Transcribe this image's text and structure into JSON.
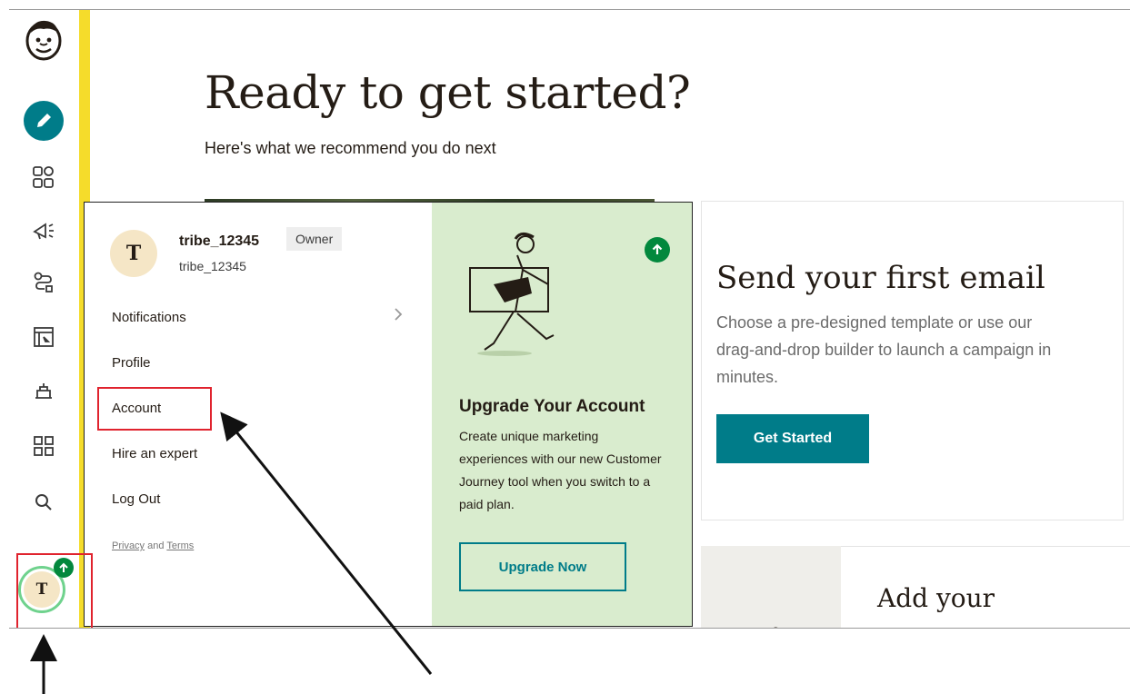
{
  "sidebar": {
    "logo": "mailchimp-freddie-logo",
    "items": [
      {
        "name": "create",
        "icon": "pencil-icon"
      },
      {
        "name": "audience",
        "icon": "audience-icon"
      },
      {
        "name": "campaigns",
        "icon": "megaphone-icon"
      },
      {
        "name": "automations",
        "icon": "automation-icon"
      },
      {
        "name": "website",
        "icon": "website-icon"
      },
      {
        "name": "content-studio",
        "icon": "content-studio-icon"
      },
      {
        "name": "integrations",
        "icon": "grid-icon"
      },
      {
        "name": "search",
        "icon": "search-icon"
      }
    ],
    "avatar_initial": "T"
  },
  "hero": {
    "title": "Ready to get started?",
    "subtitle": "Here's what we recommend you do next"
  },
  "card_email": {
    "title": "Send your first email",
    "description": "Choose a pre-designed template or use our drag-and-drop builder to launch a campaign in minutes.",
    "button_label": "Get Started"
  },
  "card_contacts": {
    "title": "Add your"
  },
  "dropdown": {
    "avatar_initial": "T",
    "username": "tribe_12345",
    "role_badge": "Owner",
    "account_name": "tribe_12345",
    "menu": [
      {
        "label": "Notifications",
        "has_chevron": true
      },
      {
        "label": "Profile"
      },
      {
        "label": "Account",
        "highlighted": true
      },
      {
        "label": "Hire an expert"
      },
      {
        "label": "Log Out"
      }
    ],
    "legal": {
      "privacy": "Privacy",
      "and": "and",
      "terms": "Terms"
    },
    "upgrade": {
      "title": "Upgrade Your Account",
      "description": "Create unique marketing experiences with our new Customer Journey tool when you switch to a paid plan.",
      "button_label": "Upgrade Now"
    }
  },
  "colors": {
    "accent_teal": "#007c89",
    "yellow_bar": "#f5dc2b",
    "upgrade_bg": "#d9ecce",
    "highlight_red": "#e0232e",
    "upgrade_badge": "#02883d"
  }
}
